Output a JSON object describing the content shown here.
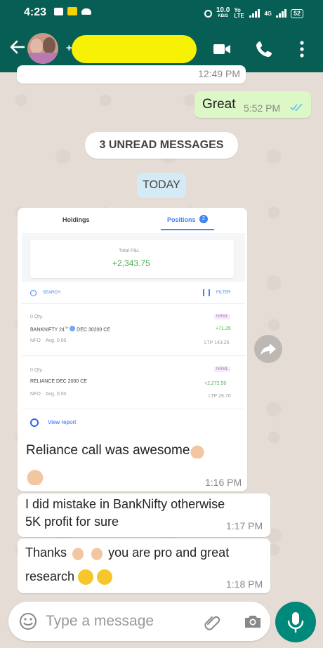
{
  "status_bar": {
    "time": "4:23",
    "network_speed_top": "10.0",
    "network_speed_bottom": "KB/S",
    "net_type": "Yo LTE",
    "net_type2": "4G",
    "battery": "52"
  },
  "header": {
    "plus": "+",
    "icons": [
      "back-arrow-icon",
      "avatar",
      "video-call-icon",
      "phone-call-icon",
      "more-options-icon"
    ]
  },
  "messages": {
    "prev_time": "12:49 PM",
    "great_text": "Great",
    "great_time": "5:52 PM",
    "unread_pill": "3 UNREAD MESSAGES",
    "today_pill": "TODAY",
    "image_caption": "Reliance call was awesome",
    "image_time": "1:16 PM",
    "msg2_line1": "I did mistake in BankNifty otherwise",
    "msg2_line2": "5K profit for sure",
    "msg2_time": "1:17 PM",
    "msg3_line1a": "Thanks",
    "msg3_line1b": "you are pro and great",
    "msg3_line2": "research",
    "msg3_time": "1:18 PM"
  },
  "screenshot": {
    "tab_holdings": "Holdings",
    "tab_positions": "Positions",
    "positions_count": "2",
    "total_pl_label": "Total P&L",
    "total_pl_value": "+2,343.75",
    "search_label": "SEARCH",
    "filter_label": "FILTER",
    "row1_qty": "0 Qty.",
    "row1_badge": "NRML",
    "row1_name": "BANKNIFTY 24",
    "row1_sup": "TH",
    "row1_name2": "DEC 30200 CE",
    "row1_pl": "+71.25",
    "row1_exch": "NFO",
    "row1_avg": "Avg. 0.00",
    "row1_ltp": "LTP 143.25",
    "row2_qty": "0 Qty.",
    "row2_badge": "NRML",
    "row2_name": "RELIANCE DEC 2000 CE",
    "row2_pl": "+2,272.50",
    "row2_exch": "NFO",
    "row2_avg": "Avg. 0.00",
    "row2_ltp": "LTP 26.70",
    "view_report": "View report"
  },
  "input": {
    "placeholder": "Type a message"
  },
  "colors": {
    "header": "#075e54",
    "outgoing": "#dcf8c6",
    "incoming": "#ffffff",
    "accent": "#00897b",
    "tick": "#4fc3f7"
  }
}
